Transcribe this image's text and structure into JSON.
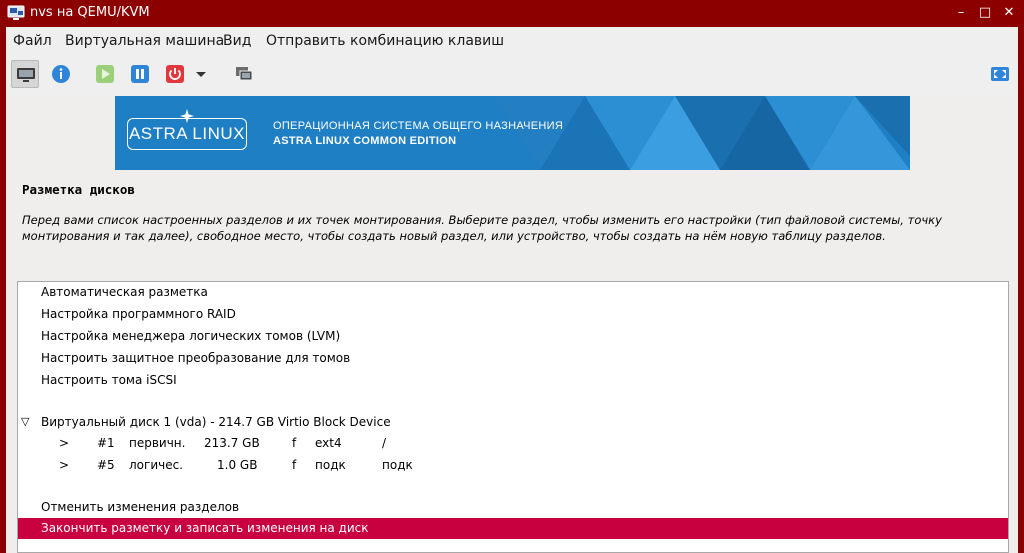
{
  "window": {
    "title": "nvs на QEMU/KVM",
    "controls": {
      "minimize": "–",
      "maximize": "□",
      "close": "✕"
    }
  },
  "menu": {
    "items": [
      "Файл",
      "Виртуальная машина",
      "Вид",
      "Отправить комбинацию клавиш"
    ]
  },
  "toolbar": {
    "icons": [
      "monitor-icon",
      "info-icon",
      "play-icon",
      "pause-icon",
      "power-icon",
      "chevron-down-icon",
      "snapshot-icon",
      "fullscreen-icon"
    ]
  },
  "banner": {
    "logo": "ASTRA LINUX",
    "line1": "ОПЕРАЦИОННАЯ СИСТЕМА ОБЩЕГО НАЗНАЧЕНИЯ",
    "line2": "ASTRA LINUX COMMON EDITION"
  },
  "installer": {
    "heading": "Разметка дисков",
    "description": "Перед вами список настроенных разделов и их точек монтирования. Выберите раздел, чтобы изменить его настройки (тип файловой системы, точку монтирования и так далее), свободное место, чтобы создать новый раздел, или устройство, чтобы создать на нём новую таблицу разделов.",
    "actions": [
      "Автоматическая разметка",
      "Настройка программного RAID",
      "Настройка менеджера логических томов (LVM)",
      "Настроить защитное преобразование для томов",
      "Настроить тома iSCSI"
    ],
    "disk": {
      "caret": "▽",
      "label": "Виртуальный диск 1 (vda) - 214.7 GB Virtio Block Device"
    },
    "partitions": [
      {
        "arrow": ">",
        "num": "#1",
        "type": "первичн.",
        "size": "213.7 GB",
        "flag": "f",
        "fs": "ext4",
        "mount": "/"
      },
      {
        "arrow": ">",
        "num": "#5",
        "type": "логичес.",
        "size": "1.0 GB",
        "flag": "f",
        "fs": "подк",
        "mount": "подк"
      }
    ],
    "undo": "Отменить изменения разделов",
    "finish": "Закончить разметку и записать изменения на диск"
  },
  "colors": {
    "frame": "#8b0000",
    "banner": "#1f7fc4",
    "selection": "#c8003f"
  }
}
